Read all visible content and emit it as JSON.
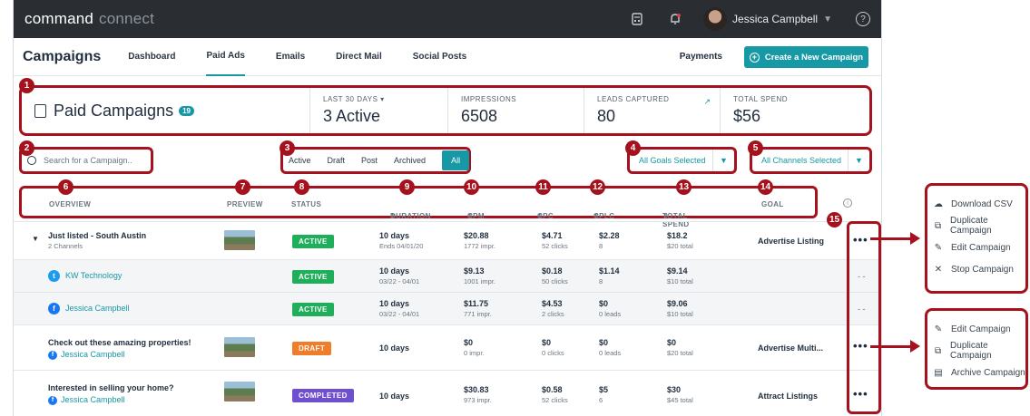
{
  "topbar": {
    "brand_primary": "command",
    "brand_secondary": "connect",
    "user_name": "Jessica Campbell"
  },
  "nav": {
    "title": "Campaigns",
    "tabs": [
      {
        "label": "Dashboard"
      },
      {
        "label": "Paid Ads"
      },
      {
        "label": "Emails"
      },
      {
        "label": "Direct Mail"
      },
      {
        "label": "Social Posts"
      }
    ],
    "payments": "Payments",
    "create_button": "Create a New Campaign"
  },
  "summary": {
    "title": "Paid Campaigns",
    "count_badge": "19",
    "period_label": "LAST 30 DAYS",
    "period_value": "3 Active",
    "impressions_label": "IMPRESSIONS",
    "impressions_value": "6508",
    "leads_label": "LEADS CAPTURED",
    "leads_value": "80",
    "spend_label": "TOTAL SPEND",
    "spend_value": "$56"
  },
  "filters": {
    "search_placeholder": "Search for a Campaign..",
    "status_filters": [
      "Active",
      "Draft",
      "Post",
      "Archived",
      "All"
    ],
    "goals_dropdown": "All Goals Selected",
    "channels_dropdown": "All Channels Selected"
  },
  "table": {
    "headers": {
      "overview": "OVERVIEW",
      "preview": "PREVIEW",
      "status": "STATUS",
      "duration": "DURATION",
      "cpm": "CPM",
      "cpc": "CPC",
      "cplc": "CPLC",
      "total_spend": "TOTAL SPEND",
      "goal": "GOAL"
    },
    "rows": [
      {
        "name": "Just listed - South Austin",
        "sub": "2 Channels",
        "status": "ACTIVE",
        "duration": "10 days",
        "duration_sub": "Ends 04/01/20",
        "cpm": "$20.88",
        "cpm_sub": "1772 impr.",
        "cpc": "$4.71",
        "cpc_sub": "52 clicks",
        "cplc": "$2.28",
        "cplc_sub": "8",
        "spend": "$18.2",
        "spend_sub": "$20 total",
        "goal": "Advertise Listing"
      },
      {
        "name": "KW Technology",
        "status": "ACTIVE",
        "duration": "10 days",
        "duration_sub": "03/22 - 04/01",
        "cpm": "$9.13",
        "cpm_sub": "1001 impr.",
        "cpc": "$0.18",
        "cpc_sub": "50 clicks",
        "cplc": "$1.14",
        "cplc_sub": "8",
        "spend": "$9.14",
        "spend_sub": "$10 total",
        "actions": "- -"
      },
      {
        "name": "Jessica Campbell",
        "status": "ACTIVE",
        "duration": "10 days",
        "duration_sub": "03/22 - 04/01",
        "cpm": "$11.75",
        "cpm_sub": "771 impr.",
        "cpc": "$4.53",
        "cpc_sub": "2 clicks",
        "cplc": "$0",
        "cplc_sub": "0 leads",
        "spend": "$9.06",
        "spend_sub": "$10 total",
        "actions": "- -"
      },
      {
        "name": "Check out these amazing properties!",
        "sub": "Jessica Campbell",
        "status": "DRAFT",
        "duration": "10 days",
        "cpm": "$0",
        "cpm_sub": "0 impr.",
        "cpc": "$0",
        "cpc_sub": "0 clicks",
        "cplc": "$0",
        "cplc_sub": "0 leads",
        "spend": "$0",
        "spend_sub": "$20 total",
        "goal": "Advertise Multi..."
      },
      {
        "name": "Interested in selling your home?",
        "sub": "Jessica Campbell",
        "status": "COMPLETED",
        "duration": "10 days",
        "cpm": "$30.83",
        "cpm_sub": "973 impr.",
        "cpc": "$0.58",
        "cpc_sub": "52 clicks",
        "cplc": "$5",
        "cplc_sub": "6",
        "spend": "$30",
        "spend_sub": "$45 total",
        "goal": "Attract Listings"
      }
    ]
  },
  "menu_active": {
    "items": [
      "Download CSV",
      "Duplicate Campaign",
      "Edit Campaign",
      "Stop Campaign"
    ]
  },
  "menu_draft": {
    "items": [
      "Edit Campaign",
      "Duplicate Campaign",
      "Archive Campaign"
    ]
  },
  "markers": [
    "1",
    "2",
    "3",
    "4",
    "5",
    "6",
    "7",
    "8",
    "9",
    "10",
    "11",
    "12",
    "13",
    "14",
    "15"
  ],
  "colors": {
    "accent": "#1798a5",
    "callout": "#a5111c",
    "active": "#1fae5a",
    "draft": "#ef7d2a",
    "completed": "#6d4fcf"
  }
}
